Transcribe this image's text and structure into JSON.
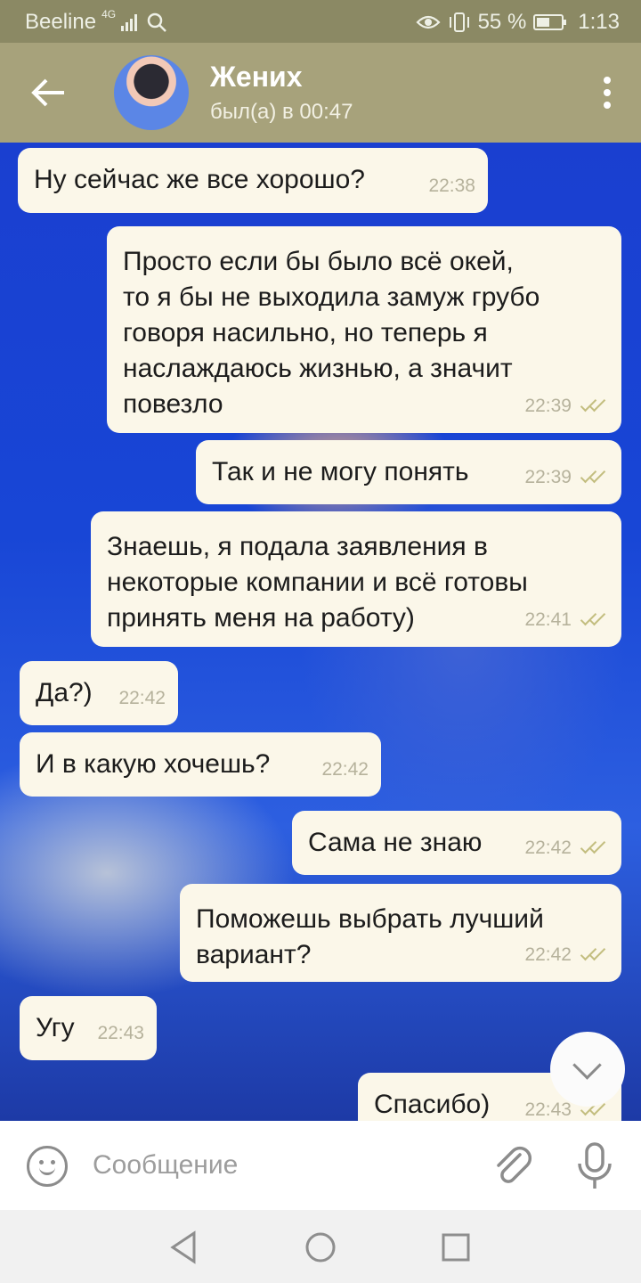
{
  "status_bar": {
    "carrier": "Beeline",
    "network": "4G",
    "battery_text": "55 %",
    "battery_level": 0.55,
    "time": "1:13"
  },
  "header": {
    "title": "Жених",
    "subtitle": "был(а) в 00:47"
  },
  "messages": [
    {
      "side": "in",
      "text": "Ну сейчас же все хорошо?",
      "time": "22:38"
    },
    {
      "side": "out",
      "text": "Просто если бы было всё окей,\nто я бы не выходила замуж грубо\nговоря насильно, но теперь я\nнаслаждаюсь жизнью, а значит\nповезло",
      "time": "22:39",
      "read": true
    },
    {
      "side": "out",
      "text": "Так и не могу понять",
      "time": "22:39",
      "read": true
    },
    {
      "side": "out",
      "text": "Знаешь, я подала заявления в\nнекоторые компании и всё готовы\nпринять меня на работу)",
      "time": "22:41",
      "read": true
    },
    {
      "side": "in",
      "text": "Да?)",
      "time": "22:42"
    },
    {
      "side": "in",
      "text": "И в какую хочешь?",
      "time": "22:42"
    },
    {
      "side": "out",
      "text": "Сама не знаю",
      "time": "22:42",
      "read": true
    },
    {
      "side": "out",
      "text": "Поможешь выбрать лучший\nвариант?",
      "time": "22:42",
      "read": true
    },
    {
      "side": "in",
      "text": "Угу",
      "time": "22:43"
    },
    {
      "side": "out",
      "text": "Спасибо)",
      "time": "22:43",
      "read": true
    }
  ],
  "input": {
    "placeholder": "Сообщение"
  },
  "icons": {
    "back": "arrow-left-icon",
    "menu": "more-vertical-icon",
    "emoji": "smiley-icon",
    "attach": "paperclip-icon",
    "mic": "microphone-icon",
    "scroll_down": "chevron-down-icon"
  },
  "colors": {
    "header": "#a7a27b",
    "status_bar": "#8b8964",
    "bubble": "#fbf7e9",
    "read_check": "#c3be80"
  }
}
